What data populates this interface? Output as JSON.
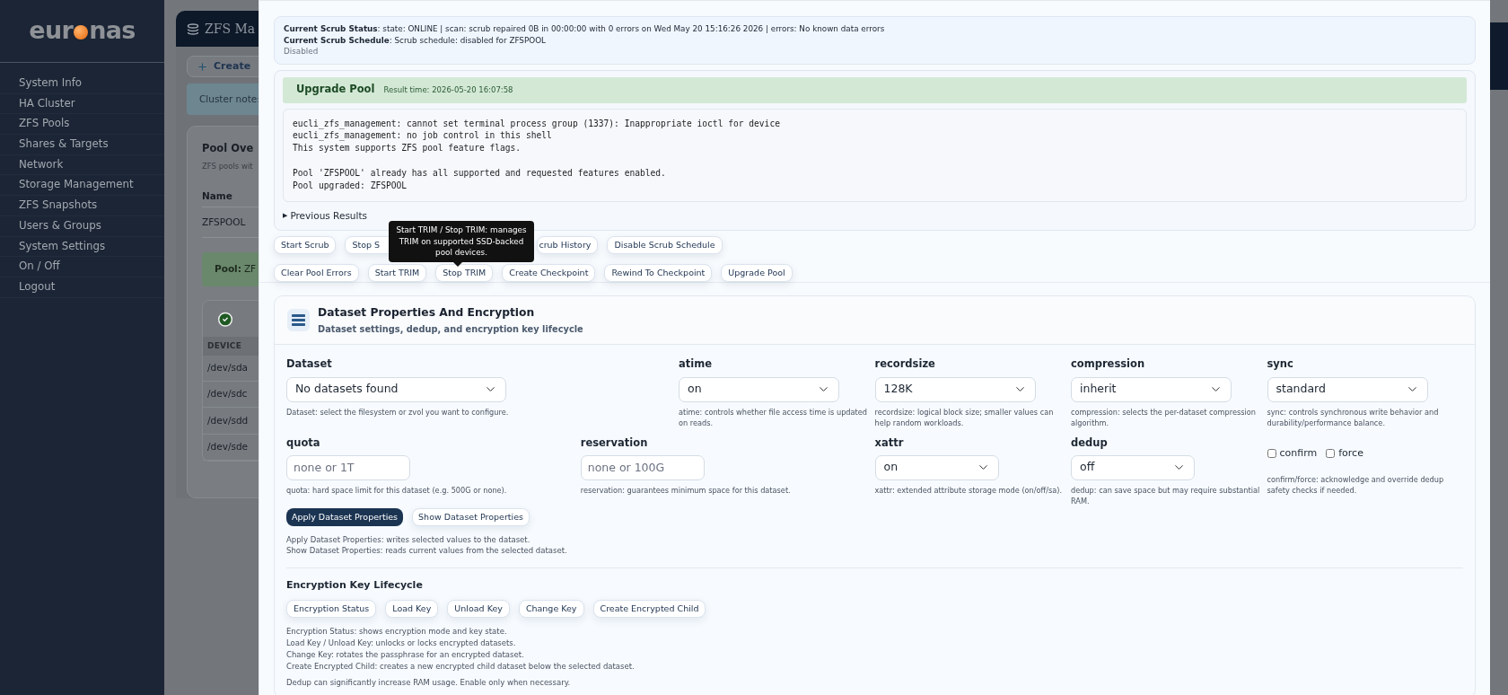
{
  "sidebar": {
    "logo": {
      "left": "eur",
      "right": "nas"
    },
    "items": [
      {
        "label": "System Info"
      },
      {
        "label": "HA Cluster"
      },
      {
        "label": "ZFS Pools"
      },
      {
        "label": "Shares & Targets"
      },
      {
        "label": "Network"
      },
      {
        "label": "Storage Management"
      },
      {
        "label": "ZFS Snapshots"
      },
      {
        "label": "Users & Groups"
      },
      {
        "label": "System Settings"
      },
      {
        "label": "On / Off"
      },
      {
        "label": "Logout"
      }
    ]
  },
  "background": {
    "header_title": "ZFS Ma",
    "create_button": "Create",
    "cluster_note": "Cluster note:",
    "pool_overview": {
      "title": "Pool Ove",
      "subtitle": "ZFS pools wit",
      "column": "Name",
      "row": "ZFSPOOL",
      "banner_label": "Pool:",
      "banner_value": "ZF",
      "device_header": "DEVICE",
      "devices": [
        "/dev/sda",
        "/dev/sdc",
        "/dev/sdd",
        "/dev/sde"
      ]
    }
  },
  "scrub": {
    "status": [
      "**Current Scrub Status**: state: ONLINE | scan: scrub repaired 0B in 00:00:00 with 0 errors on Wed May 20 15:16:26 2026 | errors: No known data errors",
      "**Current Scrub Schedule**: Scrub schedule: disabled for ZFSPOOL"
    ],
    "state": "Disabled"
  },
  "result": {
    "title": "Upgrade Pool",
    "time": "Result time: 2026-05-20 16:07:58",
    "output": [
      [
        "eucli_zfs_management: cannot set terminal process group (1337): Inappropriate ioctl for device",
        "eucli_zfs_management: no job control in this shell",
        "This system supports ZFS pool feature flags."
      ],
      [
        "Pool 'ZFSPOOL' already has all supported and requested features enabled.",
        "Pool upgraded: ZFSPOOL"
      ]
    ],
    "toggle": "▶",
    "previous": "Previous Results"
  },
  "pool_actions": [
    [
      "Start Scrub",
      "Stop S",
      "crub History",
      "Disable Scrub Schedule"
    ],
    [
      "Clear Pool Errors",
      "Start TRIM",
      "Stop TRIM",
      "Create Checkpoint",
      "Rewind To Checkpoint",
      "Upgrade Pool"
    ]
  ],
  "tooltip": "Start TRIM / Stop TRIM: manages TRIM on supported SSD-backed pool devices.",
  "dataset": {
    "title": "Dataset Properties And Encryption",
    "subtitle": "Dataset settings, dedup, and encryption key lifecycle",
    "fields": [
      {
        "kind": "select",
        "label": "Dataset",
        "value": "No datasets found",
        "help": "Dataset: select the filesystem or zvol you want to configure."
      },
      {
        "kind": "select",
        "label": "atime",
        "value": "on",
        "help": "atime: controls whether file access time is updated on reads."
      },
      {
        "kind": "select",
        "label": "recordsize",
        "value": "128K",
        "help": "recordsize: logical block size; smaller values can help random workloads."
      },
      {
        "kind": "select",
        "label": "compression",
        "value": "inherit",
        "help": "compression: selects the per-dataset compression algorithm."
      },
      {
        "kind": "select",
        "label": "sync",
        "value": "standard",
        "help": "sync: controls synchronous write behavior and durability/performance balance."
      },
      {
        "kind": "input",
        "label": "quota",
        "placeholder": "none or 1T",
        "help": "quota: hard space limit for this dataset (e.g. 500G or none)."
      },
      {
        "kind": "input",
        "label": "reservation",
        "placeholder": "none or 100G",
        "help": "reservation: guarantees minimum space for this dataset."
      },
      {
        "kind": "select",
        "label": "xattr",
        "value": "on",
        "help": "xattr: extended attribute storage mode (on/off/sa)."
      },
      {
        "kind": "select",
        "label": "dedup",
        "value": "off",
        "help": "dedup: can save space but may require substantial RAM."
      },
      {
        "kind": "checks",
        "checks": [
          {
            "label": "confirm",
            "checked": false
          },
          {
            "label": "force",
            "checked": false
          }
        ],
        "help": "confirm/force: acknowledge and override dedup safety checks if needed."
      }
    ],
    "buttons": [
      {
        "label": "Apply Dataset Properties",
        "kind": "primary"
      },
      {
        "label": "Show Dataset Properties",
        "kind": "secondary"
      }
    ],
    "buttons_help": [
      "Apply Dataset Properties: writes selected values to the dataset.",
      "Show Dataset Properties: reads current values from the selected dataset."
    ],
    "encryption": {
      "title": "Encryption Key Lifecycle",
      "buttons": [
        "Encryption Status",
        "Load Key",
        "Unload Key",
        "Change Key",
        "Create Encrypted Child"
      ],
      "help": [
        "Encryption Status: shows encryption mode and key state.",
        "Load Key / Unload Key: unlocks or locks encrypted datasets.",
        "Change Key: rotates the passphrase for an encrypted dataset.",
        "Create Encrypted Child: creates a new encrypted child dataset below the selected dataset."
      ]
    },
    "note": "Dedup can significantly increase RAM usage. Enable only when necessary."
  }
}
